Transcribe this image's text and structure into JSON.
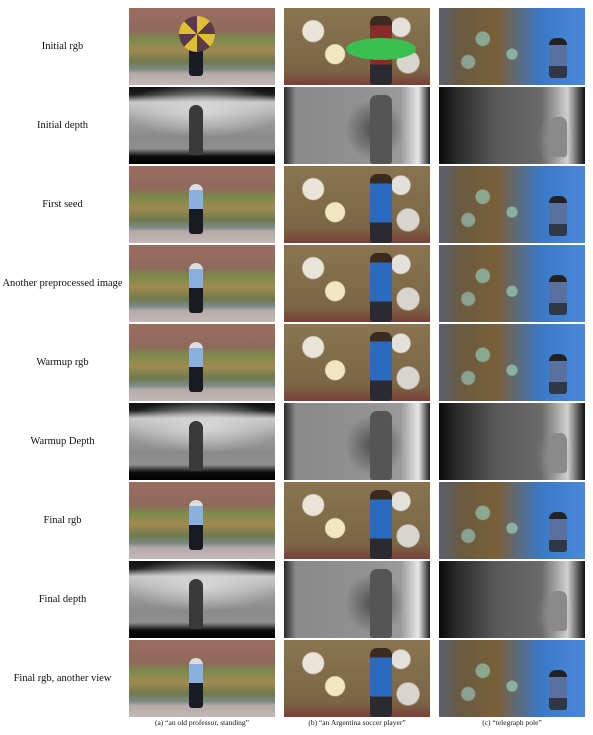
{
  "rows": [
    {
      "label": "Initial rgb",
      "kind": "rgb"
    },
    {
      "label": "Initial depth",
      "kind": "depth"
    },
    {
      "label": "First seed",
      "kind": "rgb"
    },
    {
      "label": "Another preprocessed image",
      "kind": "rgb"
    },
    {
      "label": "Warmup rgb",
      "kind": "rgb"
    },
    {
      "label": "Warmup Depth",
      "kind": "depth"
    },
    {
      "label": "Final rgb",
      "kind": "rgb"
    },
    {
      "label": "Final depth",
      "kind": "depth"
    },
    {
      "label": "Final rgb, another view",
      "kind": "rgb"
    }
  ],
  "columns": [
    {
      "caption": "(a) “an old professor, standing”",
      "image_alt": "old professor standing in front of brick wall and plants"
    },
    {
      "caption": "(b) “an Argentina soccer player”",
      "image_alt": "soccer player in front of bulletin board"
    },
    {
      "caption": "(c) “telegraph pole”",
      "image_alt": "person near a painted blue mural wall"
    }
  ]
}
